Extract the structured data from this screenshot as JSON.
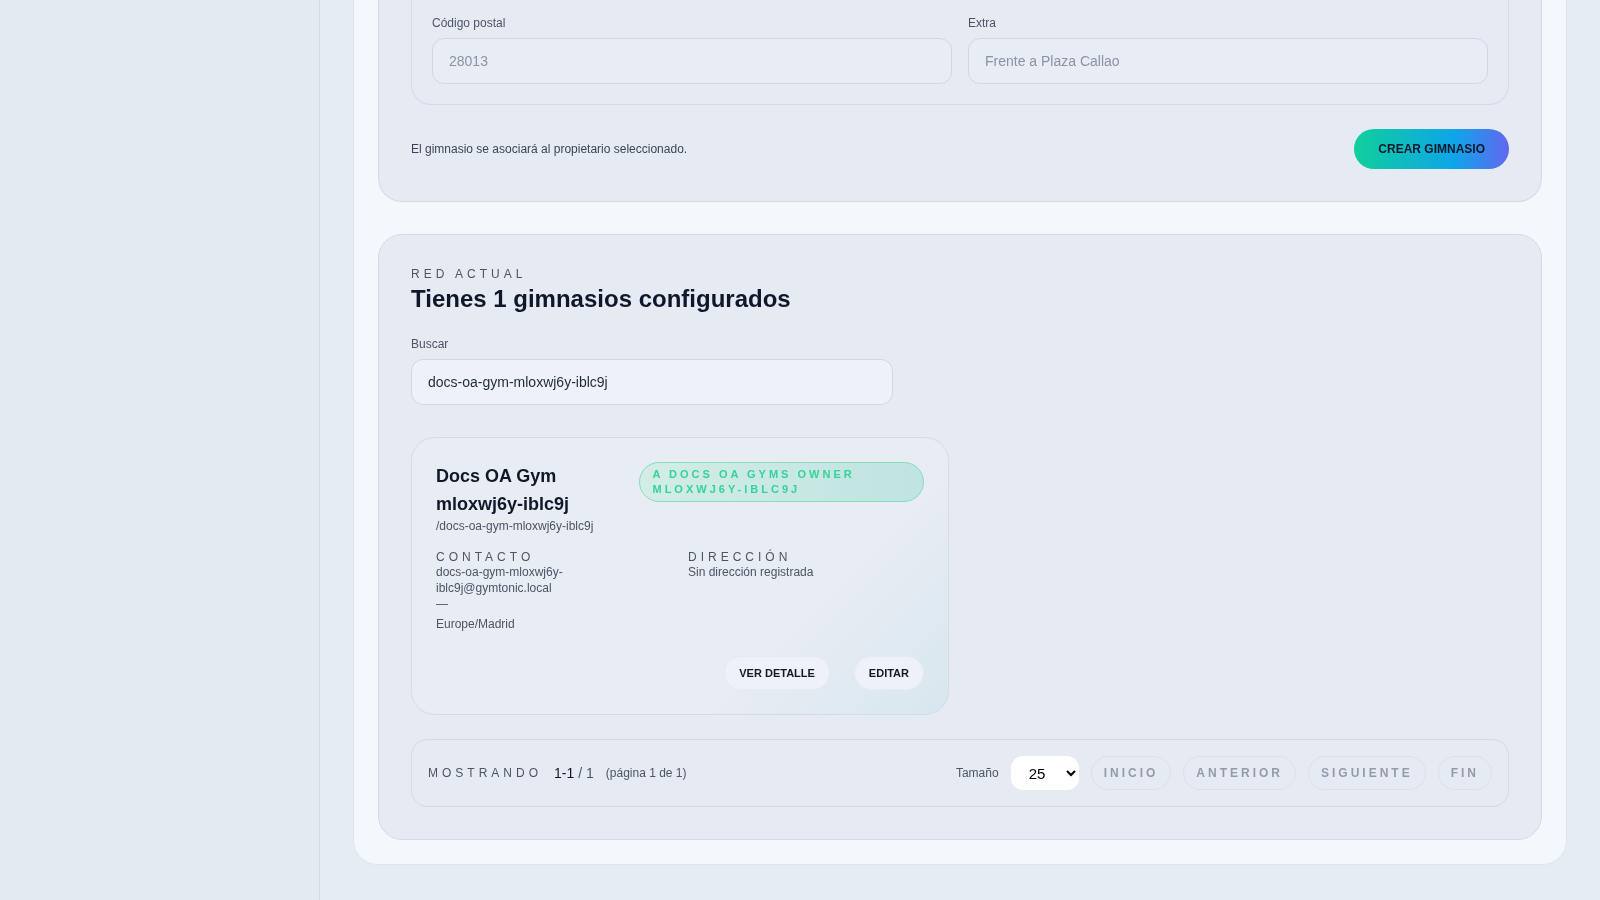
{
  "form": {
    "fields": [
      {
        "label": "Código postal",
        "placeholder": "28013"
      },
      {
        "label": "Extra",
        "placeholder": "Frente a Plaza Callao"
      }
    ],
    "note": "El gimnasio se asociará al propietario seleccionado.",
    "submit": "CREAR GIMNASIO"
  },
  "network": {
    "eyebrow": "RED ACTUAL",
    "title": "Tienes 1 gimnasios configurados",
    "search": {
      "label": "Buscar",
      "value": "docs-oa-gym-mloxwj6y-iblc9j"
    },
    "gyms": [
      {
        "name": "Docs OA Gym mloxwj6y-iblc9j",
        "slug": "/docs-oa-gym-mloxwj6y-iblc9j",
        "owner": "A DOCS OA GYMS OWNER MLOXWJ6Y-IBLC9J",
        "contact_label": "CONTACTO",
        "contact_lines": [
          "docs-oa-gym-mloxwj6y-iblc9j@gymtonic.local",
          "—",
          "Europe/Madrid"
        ],
        "address_label": "DIRECCIÓN",
        "address": "Sin dirección registrada",
        "actions": [
          "VER DETALLE",
          "EDITAR"
        ]
      }
    ],
    "pagination": {
      "label": "MOSTRANDO",
      "range": "1-1",
      "total": "/ 1",
      "page": "(página 1 de 1)",
      "size_label": "Tamaño",
      "size": "25",
      "buttons": [
        {
          "label": "INICIO",
          "disabled": true
        },
        {
          "label": "ANTERIOR",
          "disabled": true
        },
        {
          "label": "SIGUIENTE",
          "disabled": true
        },
        {
          "label": "FIN",
          "disabled": true
        }
      ]
    }
  }
}
